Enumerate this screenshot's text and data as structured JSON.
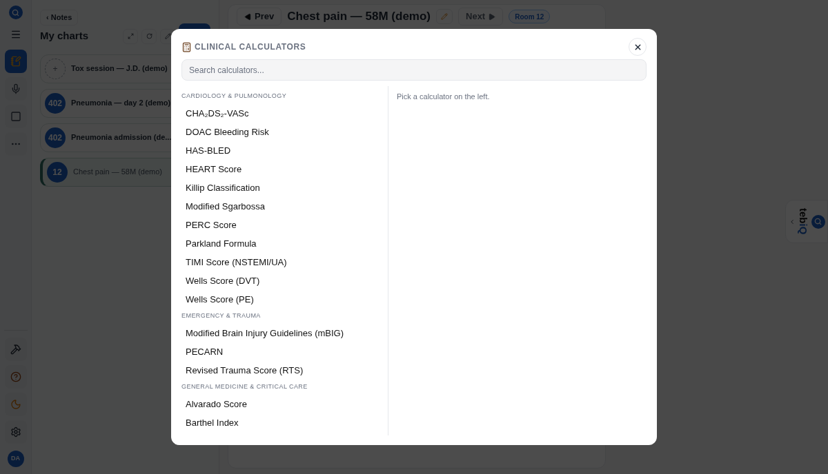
{
  "rail": {
    "avatar": "DA",
    "items": [
      {
        "selected": true
      },
      {
        "selected": false
      },
      {
        "selected": false
      },
      {
        "selected": false
      }
    ]
  },
  "sidebar": {
    "back_link": "‹ Notes",
    "title": "My charts",
    "charts": [
      {
        "kind": "new",
        "badge": "+",
        "title": "Tox session — J.D. (demo)",
        "selected": false
      },
      {
        "kind": "room",
        "badge": "402",
        "title": "Pneumonia — day 2 (demo)",
        "selected": false
      },
      {
        "kind": "room",
        "badge": "402",
        "title": "Pneumonia admission (de...",
        "selected": false
      },
      {
        "kind": "room",
        "badge": "12",
        "title": "Chest pain — 58M (demo)",
        "selected": true
      }
    ]
  },
  "chart_header": {
    "prev": "Prev",
    "title": "Chest pain — 58M (demo)",
    "next": "Next",
    "next_disabled": true,
    "room": "Room 12"
  },
  "side_tab": {
    "brand_prefix": "teb",
    "brand_suffix": "iQ"
  },
  "modal": {
    "title": "CLINICAL CALCULATORS",
    "search": {
      "placeholder": "Search calculators..."
    },
    "empty_hint": "Pick a calculator on the left.",
    "groups": [
      {
        "heading": "CARDIOLOGY & PULMONOLOGY",
        "items": [
          {
            "label": "CHA₂DS₂-VASc",
            "selected": false
          },
          {
            "label": "DOAC Bleeding Risk",
            "selected": false
          },
          {
            "label": "HAS-BLED",
            "selected": false
          },
          {
            "label": "HEART Score",
            "selected": false
          },
          {
            "label": "Killip Classification",
            "selected": false
          },
          {
            "label": "Modified Sgarbossa",
            "selected": false
          },
          {
            "label": "PERC Score",
            "selected": false
          },
          {
            "label": "Parkland Formula",
            "selected": false
          },
          {
            "label": "TIMI Score (NSTEMI/UA)",
            "selected": false
          },
          {
            "label": "Wells Score (DVT)",
            "selected": false
          },
          {
            "label": "Wells Score (PE)",
            "selected": false
          }
        ]
      },
      {
        "heading": "EMERGENCY & TRAUMA",
        "items": [
          {
            "label": "Modified Brain Injury Guidelines (mBIG)",
            "selected": false
          },
          {
            "label": "PECARN",
            "selected": false
          },
          {
            "label": "Revised Trauma Score (RTS)",
            "selected": false
          }
        ]
      },
      {
        "heading": "GENERAL MEDICINE & CRITICAL CARE",
        "items": [
          {
            "label": "Alvarado Score",
            "selected": false
          },
          {
            "label": "Barthel Index",
            "selected": false
          }
        ]
      }
    ]
  }
}
